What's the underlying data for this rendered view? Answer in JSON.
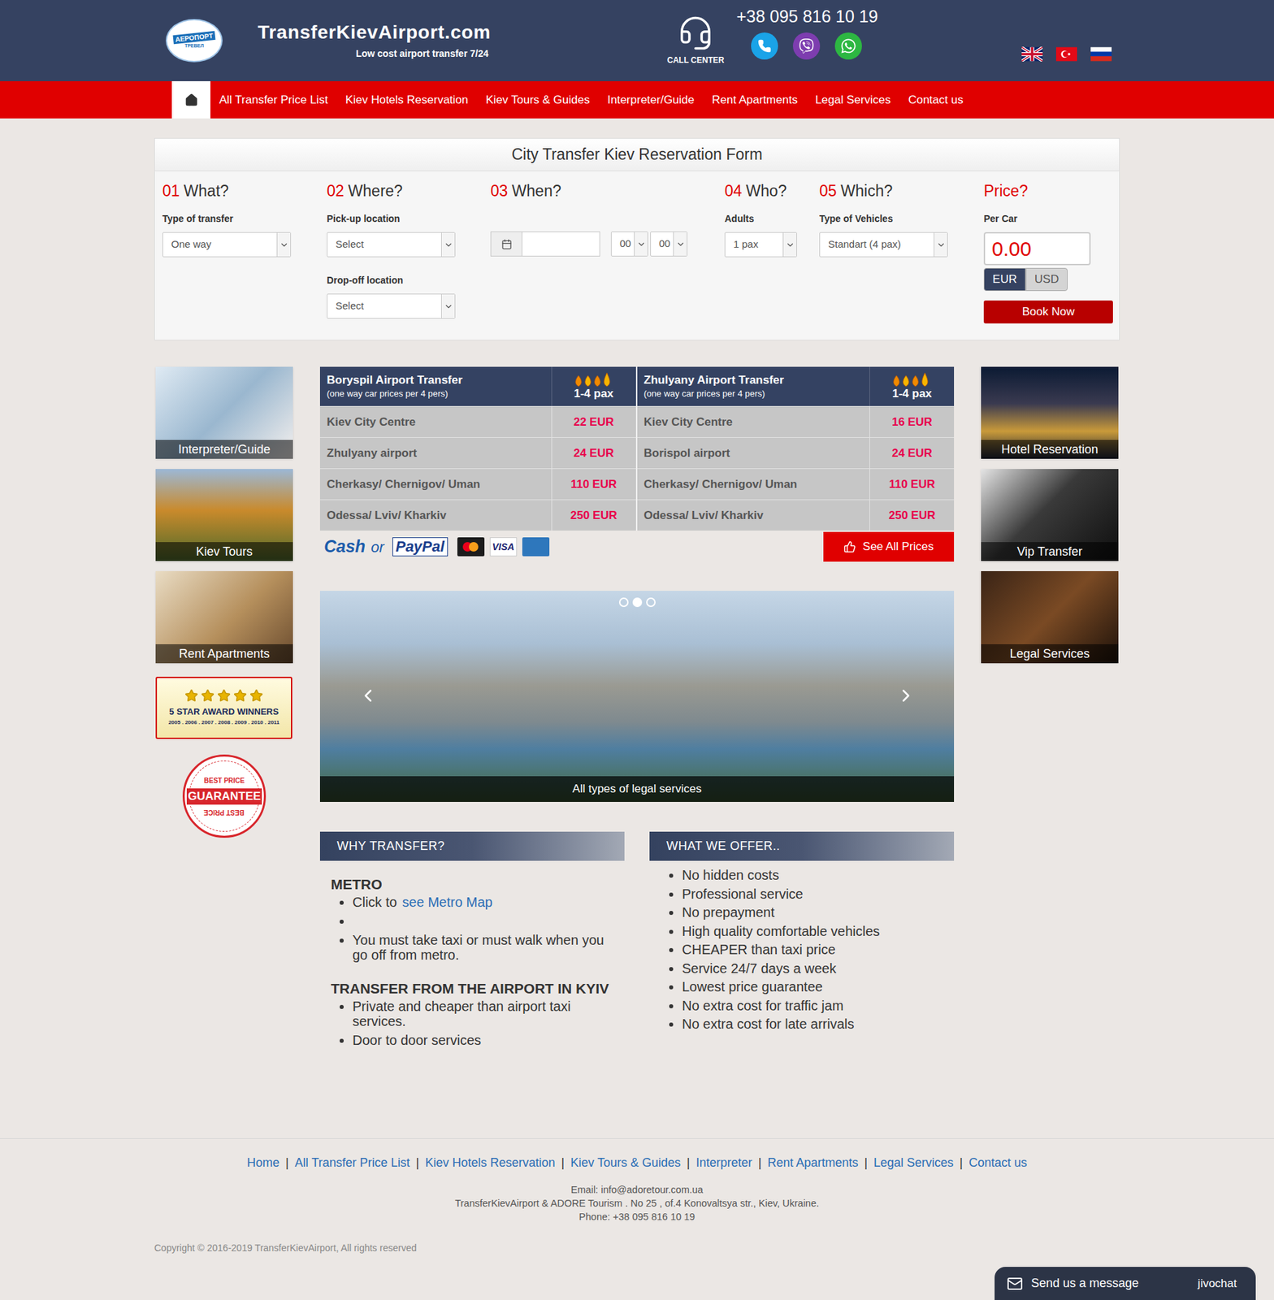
{
  "header": {
    "logo_text": "АЕРОПОРТ",
    "logo_subtext": "ТРЕВЕЛ",
    "site_name": "TransferKievAirport.com",
    "tagline": "Low cost airport transfer 7/24",
    "call_center": "CALL CENTER",
    "phone": "+38 095 816 10 19",
    "contact_apps": [
      {
        "kind": "phone",
        "color": "#1aa3e8"
      },
      {
        "kind": "viber",
        "color": "#7d3daf"
      },
      {
        "kind": "whatsapp",
        "color": "#2db742"
      }
    ],
    "languages": [
      {
        "kind": "uk",
        "selected": false
      },
      {
        "kind": "tr",
        "selected": false
      },
      {
        "kind": "ru",
        "selected": false
      }
    ]
  },
  "nav": [
    {
      "kind": "home",
      "label": "",
      "selected": true
    },
    {
      "kind": "link",
      "label": "All Transfer Price List",
      "selected": false
    },
    {
      "kind": "link",
      "label": "Kiev Hotels Reservation",
      "selected": false
    },
    {
      "kind": "link",
      "label": "Kiev Tours & Guides",
      "selected": false
    },
    {
      "kind": "link",
      "label": "Interpreter/Guide",
      "selected": false
    },
    {
      "kind": "link",
      "label": "Rent Apartments",
      "selected": false
    },
    {
      "kind": "link",
      "label": "Legal Services",
      "selected": false
    },
    {
      "kind": "link",
      "label": "Contact us",
      "selected": false
    }
  ],
  "form": {
    "title": "City Transfer Kiev Reservation Form",
    "steps": [
      {
        "kind": "step",
        "number": "01",
        "title": "What?",
        "fields": [
          {
            "kind": "select",
            "label": "Type of transfer",
            "value": "One way"
          }
        ]
      },
      {
        "kind": "step",
        "number": "02",
        "title": "Where?",
        "fields": [
          {
            "kind": "select",
            "label": "Pick-up location",
            "value": "Select"
          },
          {
            "kind": "select",
            "label": "Drop-off location",
            "value": "Select"
          }
        ]
      },
      {
        "kind": "step",
        "number": "03",
        "title": "When?",
        "fields": [
          {
            "kind": "datetime",
            "label": "",
            "value": "",
            "hour": "00",
            "minute": "00"
          }
        ]
      },
      {
        "kind": "step",
        "number": "04",
        "title": "Who?",
        "fields": [
          {
            "kind": "select",
            "label": "Adults",
            "value": "1 pax"
          }
        ]
      },
      {
        "kind": "step",
        "number": "05",
        "title": "Which?",
        "fields": [
          {
            "kind": "select",
            "label": "Type of Vehicles",
            "value": "Standart (4 pax)"
          }
        ]
      },
      {
        "kind": "price",
        "number": "",
        "title": "Price?",
        "fields": [
          {
            "kind": "price",
            "label": "Per Car",
            "value": "0.00"
          }
        ]
      }
    ],
    "currencies": [
      {
        "label": "EUR",
        "selected": true
      },
      {
        "label": "USD",
        "selected": false
      }
    ],
    "book_button": "Book Now"
  },
  "left_cards": [
    "Interpreter/Guide",
    "Kiev Tours",
    "Rent Apartments"
  ],
  "award": {
    "stars": 5,
    "title": "5 STAR AWARD WINNERS",
    "years": "2005 . 2006 . 2007 . 2008 . 2009 . 2010 . 2011"
  },
  "guarantee": {
    "top": "BEST PRICE",
    "main": "GUARANTEE",
    "bottom": "BEST PRICE"
  },
  "right_cards": [
    "Hotel Reservation",
    "Vip Transfer",
    "Legal Services"
  ],
  "price_tables": [
    {
      "title": "Boryspil Airport Transfer",
      "subtitle": "(one way car prices per 4 pers)",
      "pax": "1-4 pax",
      "rows": [
        {
          "route": "Kiev City Centre",
          "price": "22 EUR"
        },
        {
          "route": "Zhulyany airport",
          "price": "24 EUR"
        },
        {
          "route": "Cherkasy/ Chernigov/ Uman",
          "price": "110 EUR"
        },
        {
          "route": "Odessa/ Lviv/ Kharkiv",
          "price": "250 EUR"
        }
      ]
    },
    {
      "title": "Zhulyany Airport Transfer",
      "subtitle": "(one way car prices per 4 pers)",
      "pax": "1-4 pax",
      "rows": [
        {
          "route": "Kiev City Centre",
          "price": "16 EUR"
        },
        {
          "route": "Borispol airport",
          "price": "24 EUR"
        },
        {
          "route": "Cherkasy/ Chernigov/ Uman",
          "price": "110 EUR"
        },
        {
          "route": "Odessa/ Lviv/ Kharkiv",
          "price": "250 EUR"
        }
      ]
    }
  ],
  "payment": {
    "cash": "Cash",
    "or": "or",
    "paypal": "PayPal",
    "visa": "VISA"
  },
  "see_all_button": "See All Prices",
  "slider": {
    "caption": "All types of legal services",
    "dots": [
      {
        "selected": false
      },
      {
        "selected": true
      },
      {
        "selected": false
      }
    ]
  },
  "why": {
    "heading": "WHY TRANSFER?",
    "groups": [
      {
        "title": "METRO",
        "items": [
          {
            "text": "Click to",
            "link": "see Metro Map"
          },
          {
            "text": "",
            "link": ""
          },
          {
            "text": "You must take taxi or must walk when you go off from metro.",
            "link": ""
          }
        ]
      },
      {
        "title": "TRANSFER FROM THE AIRPORT IN KYIV",
        "items": [
          {
            "text": "Private and cheaper than airport taxi services.",
            "link": ""
          },
          {
            "text": "Door to door services",
            "link": ""
          }
        ]
      }
    ]
  },
  "offer": {
    "heading": "WHAT WE OFFER..",
    "items": [
      "No hidden costs",
      "Professional service",
      "No prepayment",
      "High quality comfortable vehicles",
      "CHEAPER than taxi price",
      "Service 24/7 days a week",
      "Lowest price guarantee",
      "No extra cost for traffic jam",
      "No extra cost for late arrivals"
    ]
  },
  "footer": {
    "links": [
      "Home",
      "All Transfer Price List",
      "Kiev Hotels Reservation",
      "Kiev Tours & Guides",
      "Interpreter",
      "Rent Apartments",
      "Legal Services",
      "Contact us"
    ],
    "separator": "|",
    "email": "Email: info@adoretour.com.ua",
    "address": "TransferKievAirport & ADORE Tourism . No 25 , of.4 Konovaltsya str., Kiev, Ukraine.",
    "phone": "Phone: +38 095 816 10 19",
    "copyright": "Copyright © 2016-2019 TransferKievAirport, All rights reserved"
  },
  "chat": {
    "label": "Send us a message",
    "brand": "jivochat"
  }
}
